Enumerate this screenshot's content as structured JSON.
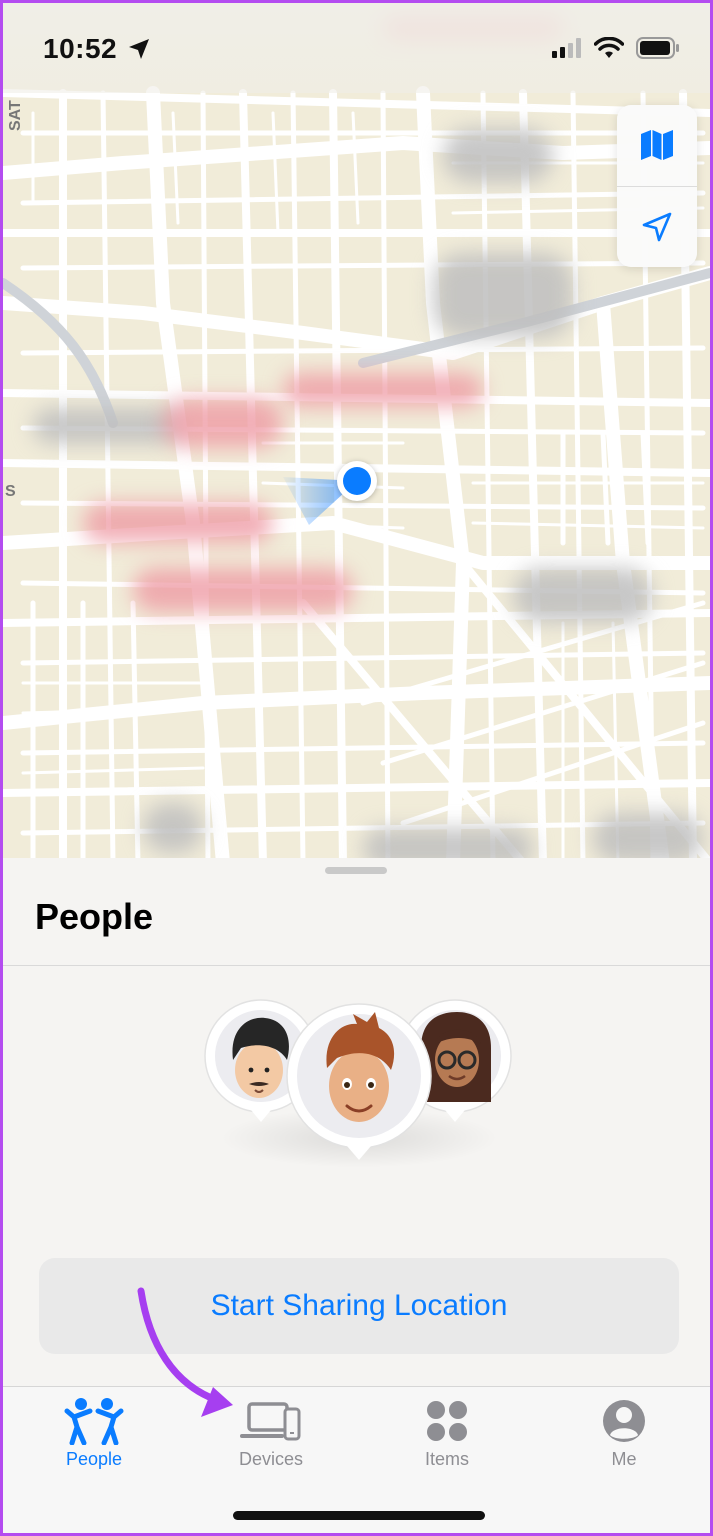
{
  "status_bar": {
    "time": "10:52"
  },
  "map": {
    "edge_label_top": "SAT",
    "edge_label_left": "S"
  },
  "sheet": {
    "title": "People",
    "start_button_label": "Start Sharing Location"
  },
  "tabs": [
    {
      "key": "people",
      "label": "People",
      "icon": "people-icon",
      "active": true
    },
    {
      "key": "devices",
      "label": "Devices",
      "icon": "devices-icon",
      "active": false
    },
    {
      "key": "items",
      "label": "Items",
      "icon": "items-icon",
      "active": false
    },
    {
      "key": "me",
      "label": "Me",
      "icon": "me-icon",
      "active": false
    }
  ],
  "colors": {
    "accent": "#0a7cff",
    "tab_inactive": "#8e8e93",
    "annotation": "#a63ff0",
    "frame_border": "#b44cf0"
  }
}
